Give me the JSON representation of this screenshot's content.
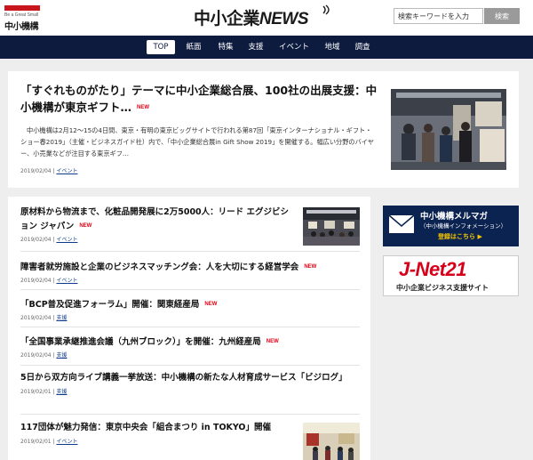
{
  "header": {
    "logo_small": "Be a Great Small",
    "logo_org": "中小機構",
    "site_title_jp": "中小企業",
    "site_title_en": "NEWS",
    "search_placeholder": "検索キーワードを入力",
    "search_button": "検索"
  },
  "nav": {
    "items": [
      {
        "label": "TOP",
        "active": true
      },
      {
        "label": "紙面"
      },
      {
        "label": "特集"
      },
      {
        "label": "支援"
      },
      {
        "label": "イベント"
      },
      {
        "label": "地域"
      },
      {
        "label": "調査"
      }
    ]
  },
  "new_label": "NEW",
  "featured": {
    "title": "「すぐれものがたり」テーマに中小企業総合展、100社の出展支援：中小機構が東京ギフト…",
    "description": "中小機構は2月12～15の4日間、東京・有明の東京ビッグサイトで行われる第87回「東京インターナショナル・ギフト・ショー春2019」（主催・ビジネスガイド社）内で、「中小企業総合展in Gift Show 2019」を開催する。幅広い分野のバイヤー、小売業などが注目する東京ギフ…",
    "date": "2019/02/04",
    "category": "イベント"
  },
  "articles": [
    {
      "title": "原材料から物流まで、化粧品開発展に2万5000人：リード エグジビション ジャパン",
      "new": true,
      "date": "2019/02/04",
      "category": "イベント",
      "has_thumb": true
    },
    {
      "title": "障害者就労施設と企業のビジネスマッチング会：人を大切にする経営学会",
      "new": true,
      "date": "2019/02/04",
      "category": "イベント"
    },
    {
      "title": "「BCP普及促進フォーラム」開催：関東経産局",
      "new": true,
      "date": "2019/02/04",
      "category": "支援"
    },
    {
      "title": "「全国事業承継推進会議（九州ブロック）」を開催：九州経産局",
      "new": true,
      "date": "2019/02/04",
      "category": "支援"
    },
    {
      "title": "5日から双方向ライブ講義一挙放送：中小機構の新たな人材育成サービス「ビジログ」",
      "new": false,
      "date": "2019/02/01",
      "category": "支援"
    },
    {
      "title": "117団体が魅力発信：東京中央会「組合まつり in TOKYO」開催",
      "new": false,
      "date": "2019/02/01",
      "category": "イベント",
      "has_thumb": true
    }
  ],
  "banners": {
    "mail": {
      "title": "中小機構メルマガ",
      "subtitle": "（中小機構インフォメーション）",
      "cta": "登録はこちら"
    },
    "jnet": {
      "logo": "J-Net21",
      "subtitle": "中小企業ビジネス支援サイト"
    }
  },
  "colors": {
    "navy": "#0d1b3f",
    "accent_red": "#e60012",
    "brand_red": "#c8161d"
  }
}
